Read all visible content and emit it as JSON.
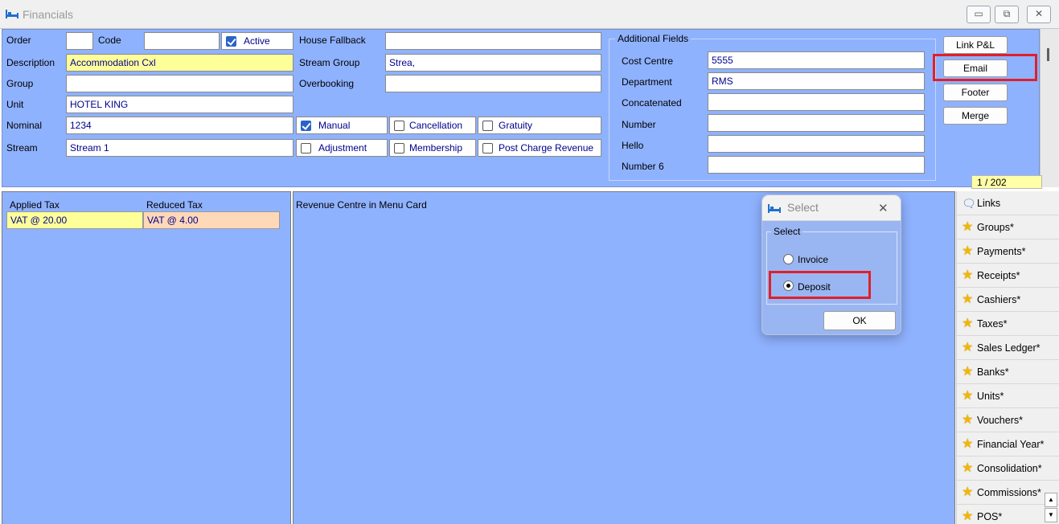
{
  "window": {
    "title": "Financials",
    "icon": "bed-icon",
    "controls": [
      "minimize",
      "restore",
      "close"
    ]
  },
  "form": {
    "order": {
      "label": "Order",
      "value": ""
    },
    "code": {
      "label": "Code",
      "value": ""
    },
    "active": {
      "label": "Active",
      "checked": true
    },
    "description": {
      "label": "Description",
      "value": "Accommodation Cxl"
    },
    "group": {
      "label": "Group",
      "value": ""
    },
    "unit": {
      "label": "Unit",
      "value": "HOTEL KING"
    },
    "nominal": {
      "label": "Nominal",
      "value": "1234"
    },
    "stream": {
      "label": "Stream",
      "value": "Stream 1"
    },
    "house_fallback": {
      "label": "House Fallback",
      "value": ""
    },
    "stream_group": {
      "label": "Stream Group",
      "value": "Strea,"
    },
    "overbooking": {
      "label": "Overbooking",
      "value": ""
    },
    "checkboxes": {
      "manual": {
        "label": "Manual",
        "checked": true
      },
      "cancellation": {
        "label": "Cancellation",
        "checked": false
      },
      "gratuity": {
        "label": "Gratuity",
        "checked": false
      },
      "adjustment": {
        "label": "Adjustment",
        "checked": false
      },
      "membership": {
        "label": "Membership",
        "checked": false
      },
      "post_charge_revenue": {
        "label": "Post Charge Revenue",
        "checked": false
      }
    }
  },
  "additional_fields": {
    "legend": "Additional Fields",
    "fields": [
      {
        "label": "Cost Centre",
        "value": "5555"
      },
      {
        "label": "Department",
        "value": "RMS"
      },
      {
        "label": "Concatenated",
        "value": ""
      },
      {
        "label": "Number",
        "value": ""
      },
      {
        "label": "Hello",
        "value": ""
      },
      {
        "label": "Number 6",
        "value": ""
      }
    ]
  },
  "side_buttons": {
    "link_pl": "Link P&L",
    "email": "Email",
    "footer": "Footer",
    "merge": "Merge"
  },
  "record_counter": "1 / 202",
  "tax_table": {
    "headers": [
      "Applied Tax",
      "Reduced Tax"
    ],
    "applied": "VAT @ 20.00",
    "reduced": "VAT @ 4.00"
  },
  "revenue_panel": {
    "title": "Revenue Centre in Menu Card"
  },
  "nav": [
    {
      "label": "Links",
      "icon": "links-icon"
    },
    {
      "label": "Groups*",
      "icon": "star-icon"
    },
    {
      "label": "Payments*",
      "icon": "star-icon"
    },
    {
      "label": "Receipts*",
      "icon": "star-icon"
    },
    {
      "label": "Cashiers*",
      "icon": "star-icon"
    },
    {
      "label": "Taxes*",
      "icon": "star-icon"
    },
    {
      "label": "Sales Ledger*",
      "icon": "star-icon"
    },
    {
      "label": "Banks*",
      "icon": "star-icon"
    },
    {
      "label": "Units*",
      "icon": "star-icon"
    },
    {
      "label": "Vouchers*",
      "icon": "star-icon"
    },
    {
      "label": "Financial Year*",
      "icon": "star-icon"
    },
    {
      "label": "Consolidation*",
      "icon": "star-icon"
    },
    {
      "label": "Commissions*",
      "icon": "star-icon"
    },
    {
      "label": "POS*",
      "icon": "star-icon"
    }
  ],
  "dialog": {
    "title": "Select",
    "close": "✕",
    "group_label": "Select",
    "options": [
      {
        "label": "Invoice",
        "selected": false
      },
      {
        "label": "Deposit",
        "selected": true
      }
    ],
    "ok": "OK"
  },
  "colors": {
    "panel_bg": "#8fb2ff",
    "highlight_yellow": "#ffff9a",
    "highlight_peach": "#ffd8b8",
    "annotation_red": "#e0202a",
    "field_text": "#00008b"
  }
}
